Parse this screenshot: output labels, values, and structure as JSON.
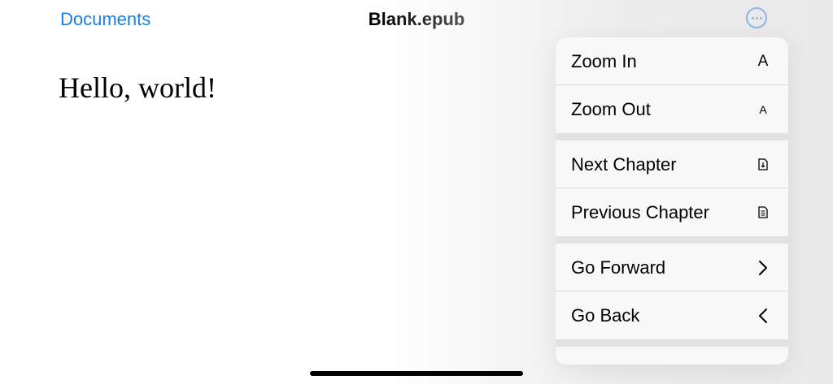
{
  "nav": {
    "back_label": "Documents",
    "title": "Blank.epub",
    "more_icon": "ellipsis-circle-icon"
  },
  "content": {
    "text": "Hello, world!"
  },
  "menu": {
    "items": [
      {
        "label": "Zoom In",
        "icon": "A"
      },
      {
        "label": "Zoom Out",
        "icon": "A"
      },
      {
        "label": "Next Chapter",
        "icon": "next-chapter-doc-icon"
      },
      {
        "label": "Previous Chapter",
        "icon": "previous-chapter-doc-icon"
      },
      {
        "label": "Go Forward",
        "icon": "chevron-right-icon"
      },
      {
        "label": "Go Back",
        "icon": "chevron-left-icon"
      }
    ]
  },
  "colors": {
    "accent": "#1a7ee6",
    "menu_bg": "#f8f8f8",
    "separator": "#e2e2e2"
  }
}
